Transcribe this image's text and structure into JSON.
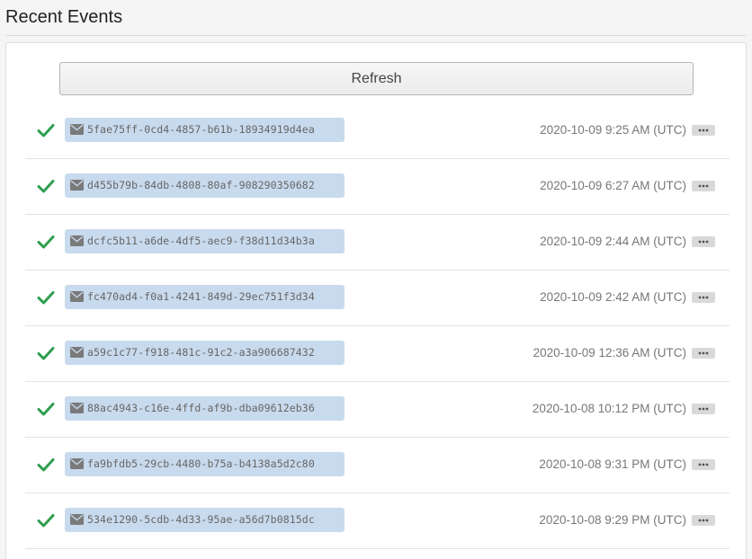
{
  "header": {
    "title": "Recent Events"
  },
  "toolbar": {
    "refresh_label": "Refresh"
  },
  "colors": {
    "success": "#2e9e4f",
    "badge_bg": "#c8daed",
    "icon_gray": "#7a7a7a"
  },
  "icons": {
    "status": "check-icon",
    "event": "envelope-icon",
    "menu": "more-icon"
  },
  "events": [
    {
      "id": "5fae75ff-0cd4-4857-b61b-18934919d4ea",
      "time": "2020-10-09 9:25 AM (UTC)",
      "status": "success"
    },
    {
      "id": "d455b79b-84db-4808-80af-908290350682",
      "time": "2020-10-09 6:27 AM (UTC)",
      "status": "success"
    },
    {
      "id": "dcfc5b11-a6de-4df5-aec9-f38d11d34b3a",
      "time": "2020-10-09 2:44 AM (UTC)",
      "status": "success"
    },
    {
      "id": "fc470ad4-f0a1-4241-849d-29ec751f3d34",
      "time": "2020-10-09 2:42 AM (UTC)",
      "status": "success"
    },
    {
      "id": "a59c1c77-f918-481c-91c2-a3a906687432",
      "time": "2020-10-09 12:36 AM (UTC)",
      "status": "success"
    },
    {
      "id": "88ac4943-c16e-4ffd-af9b-dba09612eb36",
      "time": "2020-10-08 10:12 PM (UTC)",
      "status": "success"
    },
    {
      "id": "fa9bfdb5-29cb-4480-b75a-b4138a5d2c80",
      "time": "2020-10-08 9:31 PM (UTC)",
      "status": "success"
    },
    {
      "id": "534e1290-5cdb-4d33-95ae-a56d7b0815dc",
      "time": "2020-10-08 9:29 PM (UTC)",
      "status": "success"
    }
  ]
}
